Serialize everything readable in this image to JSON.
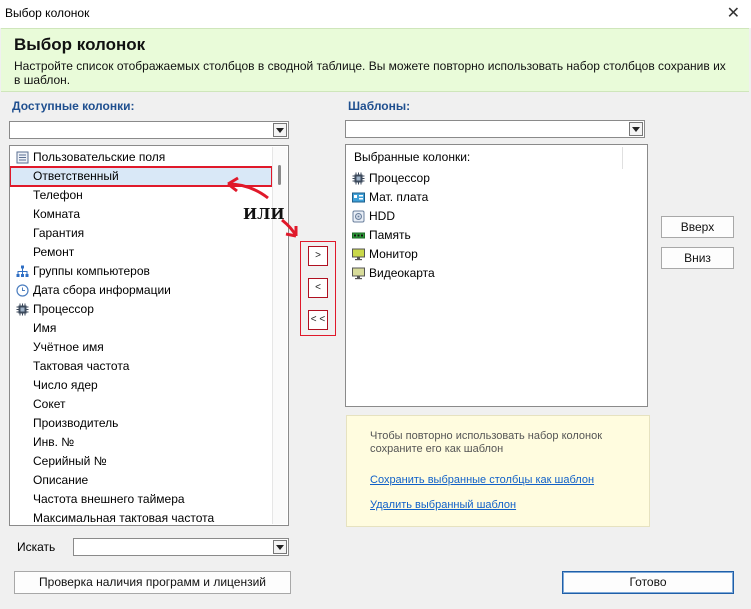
{
  "window": {
    "title": "Выбор колонок"
  },
  "header": {
    "title": "Выбор колонок",
    "description": "Настройте список отображаемых столбцов в сводной таблице. Вы можете повторно использовать набор столбцов сохранив их в шаблон."
  },
  "available": {
    "label": "Доступные колонки:",
    "items": [
      "Пользовательские поля",
      "Ответственный",
      "Телефон",
      "Комната",
      "Гарантия",
      "Ремонт",
      "Группы компьютеров",
      "Дата сбора информации",
      "Процессор",
      "Имя",
      "Учётное имя",
      "Тактовая частота",
      "Число ядер",
      "Сокет",
      "Производитель",
      "Инв. №",
      "Серийный №",
      "Описание",
      "Частота внешнего таймера",
      "Максимальная тактовая частота"
    ]
  },
  "annotation": {
    "text": "ИЛИ"
  },
  "move_buttons": {
    "add": ">",
    "remove": "<",
    "remove_all": "< <"
  },
  "templates": {
    "label": "Шаблоны:",
    "selected_header": "Выбранные колонки:",
    "selected_items": [
      "Процессор",
      "Мат. плата",
      "HDD",
      "Память",
      "Монитор",
      "Видеокарта"
    ]
  },
  "order_buttons": {
    "up": "Вверх",
    "down": "Вниз"
  },
  "info": {
    "text": "Чтобы повторно использовать набор колонок сохраните его как шаблон",
    "save_link": "Сохранить выбранные столбцы как шаблон",
    "delete_link": "Удалить выбранный шаблон"
  },
  "search": {
    "label": "Искать",
    "value": ""
  },
  "footer": {
    "check_button": "Проверка наличия программ и лицензий",
    "ok_button": "Готово"
  },
  "colors": {
    "accent": "#1f4f8f",
    "header_bg": "#e9fbd9",
    "annotation_red": "#e0192a",
    "link": "#1060c8"
  }
}
